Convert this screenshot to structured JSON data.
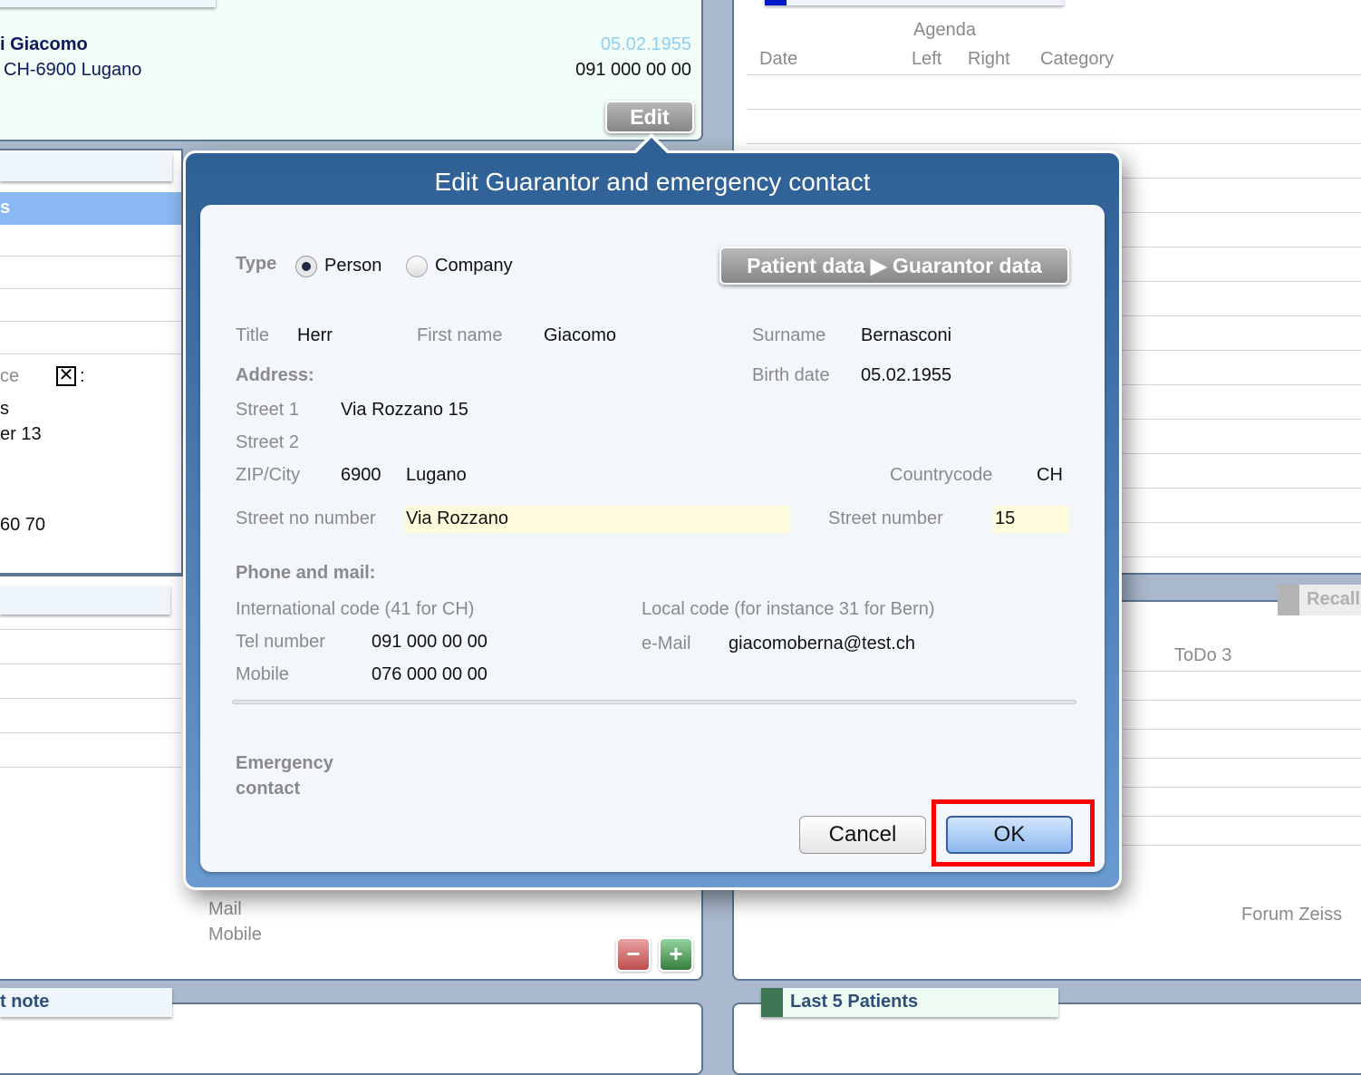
{
  "patient_card": {
    "name": "i Giacomo",
    "address": "CH-6900 Lugano",
    "birth_date": "05.02.1955",
    "phone": "091 000 00 00",
    "edit_label": "Edit"
  },
  "agenda": {
    "header_top": "Agenda",
    "columns": [
      "Date",
      "Left",
      "Right",
      "Category"
    ]
  },
  "left_panel": {
    "label_partial": "ce",
    "checkbox_suffix": ":",
    "lines": [
      "s",
      "er 13",
      "60 70"
    ]
  },
  "contact_panel": {
    "labels": [
      "Mail",
      "Mobile"
    ]
  },
  "recalls": {
    "tab": "Recall",
    "todo": "ToDo 3",
    "forum": "Forum Zeiss"
  },
  "bottom": {
    "note_tab": "t note",
    "last_patients_tab": "Last 5 Patients"
  },
  "dialog": {
    "title": "Edit Guarantor and emergency contact",
    "type_label": "Type",
    "type_options": [
      {
        "label": "Person",
        "selected": true
      },
      {
        "label": "Company",
        "selected": false
      }
    ],
    "copy_button": "Patient data ▶ Guarantor data",
    "title_label": "Title",
    "title_value": "Herr",
    "first_name_label": "First name",
    "first_name_value": "Giacomo",
    "surname_label": "Surname",
    "surname_value": "Bernasconi",
    "address_heading": "Address:",
    "birth_date_label": "Birth date",
    "birth_date_value": "05.02.1955",
    "street1_label": "Street 1",
    "street1_value": "Via Rozzano 15",
    "street2_label": "Street 2",
    "zip_city_label": "ZIP/City",
    "zip_value": "6900",
    "city_value": "Lugano",
    "countrycode_label": "Countrycode",
    "countrycode_value": "CH",
    "street_no_number_label": "Street no number",
    "street_no_number_value": "Via Rozzano",
    "street_number_label": "Street number",
    "street_number_value": "15",
    "phone_heading": "Phone and mail:",
    "intl_code_label": "International code (41 for CH)",
    "local_code_label": "Local code (for instance 31 for Bern)",
    "tel_label": "Tel number",
    "tel_value": "091 000 00 00",
    "email_label": "e-Mail",
    "email_value": "giacomoberna@test.ch",
    "mobile_label": "Mobile",
    "mobile_value": "076 000 00 00",
    "emergency_heading": "Emergency contact",
    "cancel_label": "Cancel",
    "ok_label": "OK"
  },
  "colors": {
    "dialog_blue": "#2e6095",
    "highlight_field": "#fefbdc",
    "ok_highlight": "#ff0000"
  }
}
